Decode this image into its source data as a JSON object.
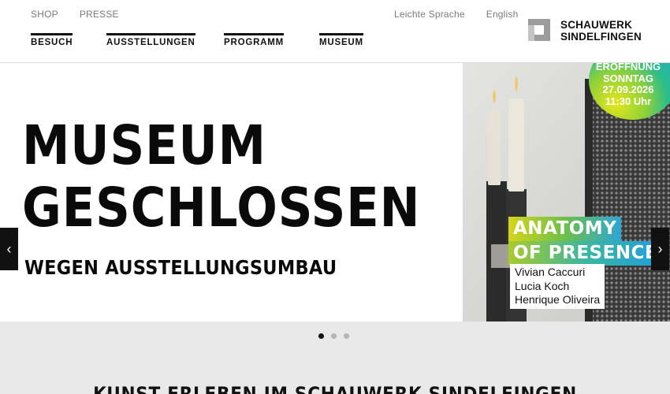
{
  "header": {
    "top_links": [
      "SHOP",
      "PRESSE"
    ],
    "lang_links": [
      "Leichte Sprache",
      "English"
    ],
    "nav": [
      "BESUCH",
      "AUSSTELLUNGEN",
      "PROGRAMM",
      "MUSEUM"
    ],
    "logo": {
      "line1": "SCHAUWERK",
      "line2": "SINDELFINGEN"
    }
  },
  "hero": {
    "headline_line1": "MUSEUM",
    "headline_line2": "GESCHLOSSEN",
    "subline": "WEGEN AUSSTELLUNGSUMBAU",
    "badge": {
      "line1": "ERÖFFNUNG",
      "line2": "SONNTAG",
      "line3": "27.09.2026",
      "line4": "11:30 Uhr"
    },
    "exhibition": {
      "title_line1": "ANATOMY",
      "title_line2": "OF PRESENCE",
      "artists": [
        "Vivian Caccuri",
        "Lucia Koch",
        "Henrique Oliveira"
      ]
    },
    "prev_glyph": "‹",
    "next_glyph": "›"
  },
  "carousel": {
    "slide_count": 3,
    "active_index": 0
  },
  "section": {
    "title": "KUNST ERLEBEN IM SCHAUWERK SINDELFINGEN"
  },
  "colors": {
    "accent_green": "#6bbf4a",
    "accent_blue": "#1ea6d8",
    "accent_yellow": "#e4e61b"
  }
}
